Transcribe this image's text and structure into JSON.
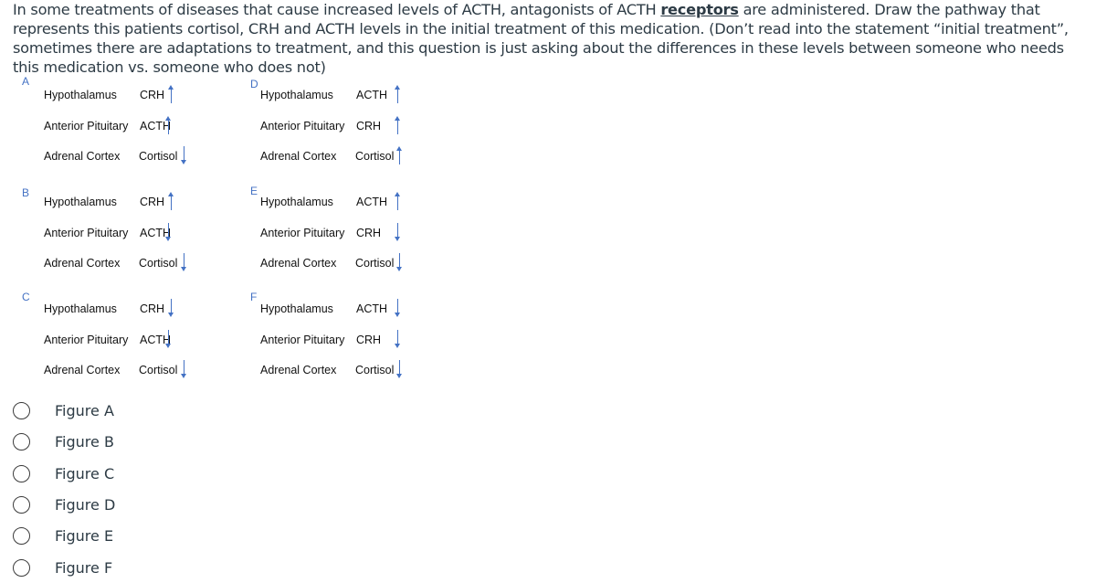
{
  "question": {
    "part1": "In some treatments of diseases that cause increased levels of ACTH, antagonists of ACTH ",
    "underlined": "receptors",
    "part2": " are administered. Draw the pathway that represents this patients cortisol, CRH and ACTH levels in the initial treatment of this medication. (Don’t read into the statement “initial treatment”, sometimes there are adaptations to treatment, and this question is just asking about the differences in these levels between someone who needs this medication vs. someone who does not)"
  },
  "figures": [
    {
      "letter": "A",
      "rows": [
        {
          "organ": "Hypothalamus",
          "hormone": "CRH",
          "direction": "up"
        },
        {
          "organ": "Anterior Pituitary",
          "hormone": "ACTH",
          "direction": "up"
        },
        {
          "organ": "Adrenal Cortex",
          "hormone": "Cortisol",
          "direction": "down"
        }
      ]
    },
    {
      "letter": "B",
      "rows": [
        {
          "organ": "Hypothalamus",
          "hormone": "CRH",
          "direction": "up"
        },
        {
          "organ": "Anterior Pituitary",
          "hormone": "ACTH",
          "direction": "down"
        },
        {
          "organ": "Adrenal Cortex",
          "hormone": "Cortisol",
          "direction": "down"
        }
      ]
    },
    {
      "letter": "C",
      "rows": [
        {
          "organ": "Hypothalamus",
          "hormone": "CRH",
          "direction": "down"
        },
        {
          "organ": "Anterior Pituitary",
          "hormone": "ACTH",
          "direction": "down"
        },
        {
          "organ": "Adrenal Cortex",
          "hormone": "Cortisol",
          "direction": "down"
        }
      ]
    },
    {
      "letter": "D",
      "rows": [
        {
          "organ": "Hypothalamus",
          "hormone": "ACTH",
          "direction": "up"
        },
        {
          "organ": "Anterior Pituitary",
          "hormone": "CRH",
          "direction": "up"
        },
        {
          "organ": "Adrenal Cortex",
          "hormone": "Cortisol",
          "direction": "up"
        }
      ]
    },
    {
      "letter": "E",
      "rows": [
        {
          "organ": "Hypothalamus",
          "hormone": "ACTH",
          "direction": "up"
        },
        {
          "organ": "Anterior Pituitary",
          "hormone": "CRH",
          "direction": "down"
        },
        {
          "organ": "Adrenal Cortex",
          "hormone": "Cortisol",
          "direction": "down"
        }
      ]
    },
    {
      "letter": "F",
      "rows": [
        {
          "organ": "Hypothalamus",
          "hormone": "ACTH",
          "direction": "down"
        },
        {
          "organ": "Anterior Pituitary",
          "hormone": "CRH",
          "direction": "down"
        },
        {
          "organ": "Adrenal Cortex",
          "hormone": "Cortisol",
          "direction": "down"
        }
      ]
    }
  ],
  "options": [
    {
      "label": "Figure A",
      "selected": false
    },
    {
      "label": "Figure B",
      "selected": false
    },
    {
      "label": "Figure C",
      "selected": false
    },
    {
      "label": "Figure D",
      "selected": false
    },
    {
      "label": "Figure E",
      "selected": false
    },
    {
      "label": "Figure F",
      "selected": false
    }
  ],
  "colors": {
    "arrow": "#4472c4",
    "letter": "#4472c4",
    "text": "#2d3b45"
  }
}
